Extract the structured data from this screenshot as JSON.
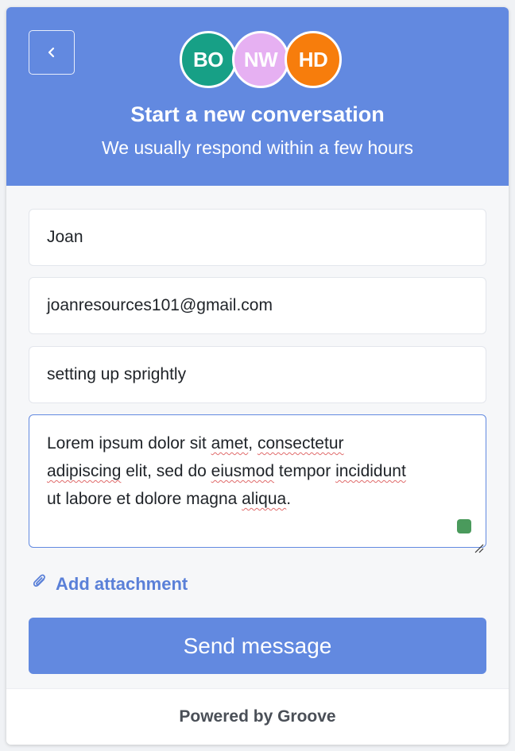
{
  "header": {
    "title": "Start a new conversation",
    "subtitle": "We usually respond within a few hours",
    "background_color": "#6289e0",
    "avatars": [
      {
        "initials": "BO",
        "color": "#17a086"
      },
      {
        "initials": "NW",
        "color": "#e6b0f2"
      },
      {
        "initials": "HD",
        "color": "#f77d0c"
      }
    ]
  },
  "form": {
    "name_value": "Joan",
    "email_value": "joanresources101@gmail.com",
    "subject_value": "setting up sprightly",
    "message": {
      "w1": "Lorem ipsum dolor sit ",
      "w2": "amet",
      "w3": ", ",
      "w4": "consectetur",
      "w5": "adipiscing",
      "w6": " elit, sed do ",
      "w7": "eiusmod",
      "w8": " tempor ",
      "w9": "incididunt",
      "w10": "ut labore et dolore magna ",
      "w11": "aliqua",
      "w12": "."
    },
    "attachment_label": "Add attachment",
    "send_label": "Send message"
  },
  "footer": {
    "text": "Powered by Groove"
  }
}
